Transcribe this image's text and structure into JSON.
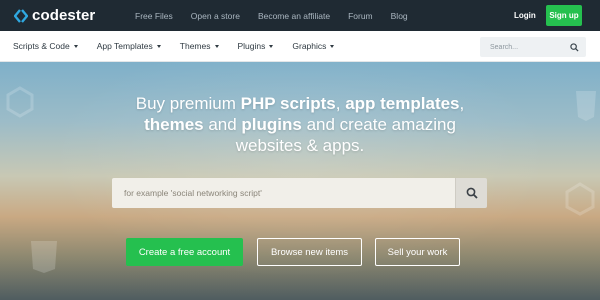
{
  "header": {
    "brand": "codester",
    "nav": [
      "Free Files",
      "Open a store",
      "Become an affiliate",
      "Forum",
      "Blog"
    ],
    "login_label": "Login",
    "signup_label": "Sign up"
  },
  "subnav": {
    "items": [
      "Scripts & Code",
      "App Templates",
      "Themes",
      "Plugins",
      "Graphics"
    ],
    "search_placeholder": "Search..."
  },
  "hero": {
    "line1_pre": "Buy premium ",
    "line1_b1": "PHP scripts",
    "line1_mid": ", ",
    "line1_b2": "app templates",
    "line1_post": ",",
    "line2_b1": "themes",
    "line2_mid": " and ",
    "line2_b2": "plugins",
    "line2_post": " and create amazing",
    "line3": "websites & apps.",
    "search_placeholder": "for example 'social networking script'",
    "btn_create": "Create a free account",
    "btn_browse": "Browse new items",
    "btn_sell": "Sell your work"
  },
  "colors": {
    "topbar": "#1f2a33",
    "accent_green": "#25c04f"
  },
  "icons": {
    "logo": "codester-logo-icon",
    "search": "search-icon"
  }
}
